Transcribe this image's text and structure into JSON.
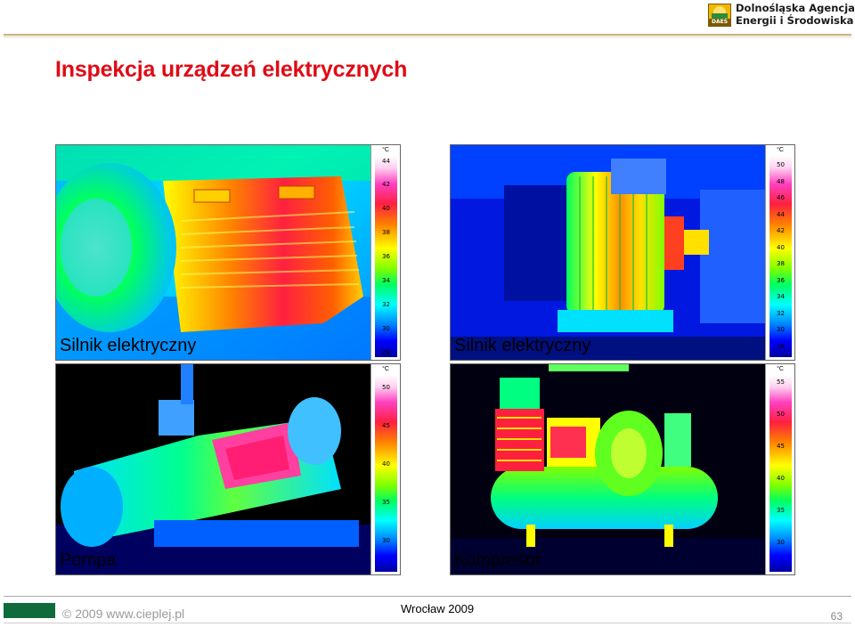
{
  "header": {
    "logo_line1": "Dolnośląska Agencja",
    "logo_line2": "Energii i Środowiska",
    "logo_badge": "DAEŚ"
  },
  "slide": {
    "title": "Inspekcja urządzeń elektrycznych"
  },
  "panels": [
    {
      "caption": "Silnik elektryczny",
      "unit": "°C",
      "scale_ticks": [
        "44",
        "42",
        "40",
        "38",
        "36",
        "34",
        "32",
        "30",
        "28"
      ]
    },
    {
      "caption": "Silnik elektryczny",
      "unit": "°C",
      "scale_ticks": [
        "50",
        "48",
        "46",
        "44",
        "42",
        "40",
        "38",
        "36",
        "34",
        "32",
        "30",
        "28"
      ]
    },
    {
      "caption": "Pompa",
      "unit": "°C",
      "scale_ticks": [
        "50",
        "45",
        "40",
        "35",
        "30"
      ]
    },
    {
      "caption": "Kompresor",
      "unit": "°C",
      "scale_ticks": [
        "55",
        "50",
        "45",
        "40",
        "35",
        "30"
      ]
    }
  ],
  "footer": {
    "copyright": "© 2009 www.cieplej.pl",
    "location": "Wrocław 2009",
    "page_number": "63"
  }
}
